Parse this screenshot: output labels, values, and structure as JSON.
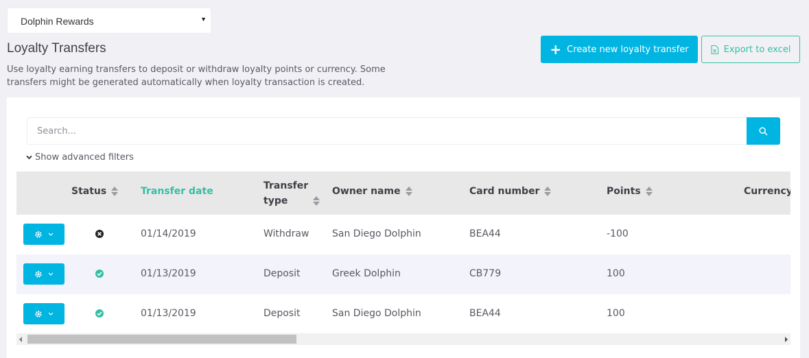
{
  "program_select": {
    "value": "Dolphin Rewards"
  },
  "header": {
    "title": "Loyalty Transfers",
    "description": "Use loyalty earning transfers to deposit or withdraw loyalty points or currency. Some transfers might be generated automatically when loyalty transaction is created.",
    "create_label": "Create new loyalty transfer",
    "export_label": "Export to excel"
  },
  "search": {
    "placeholder": "Search...",
    "advanced_label": "Show advanced filters"
  },
  "table": {
    "columns": [
      "Status",
      "Transfer date",
      "Transfer type",
      "Owner name",
      "Card number",
      "Points",
      "Currency"
    ],
    "sorted_column": "Transfer date",
    "rows": [
      {
        "status": "cancelled",
        "date": "01/14/2019",
        "type": "Withdraw",
        "owner": "San Diego Dolphin",
        "card": "BEA44",
        "points": "-100"
      },
      {
        "status": "completed",
        "date": "01/13/2019",
        "type": "Deposit",
        "owner": "Greek Dolphin",
        "card": "CB779",
        "points": "100"
      },
      {
        "status": "completed",
        "date": "01/13/2019",
        "type": "Deposit",
        "owner": "San Diego Dolphin",
        "card": "BEA44",
        "points": "100"
      }
    ]
  },
  "colors": {
    "accent": "#00b5e2",
    "success": "#34bfa3",
    "header_bg": "#e8e8e8"
  }
}
